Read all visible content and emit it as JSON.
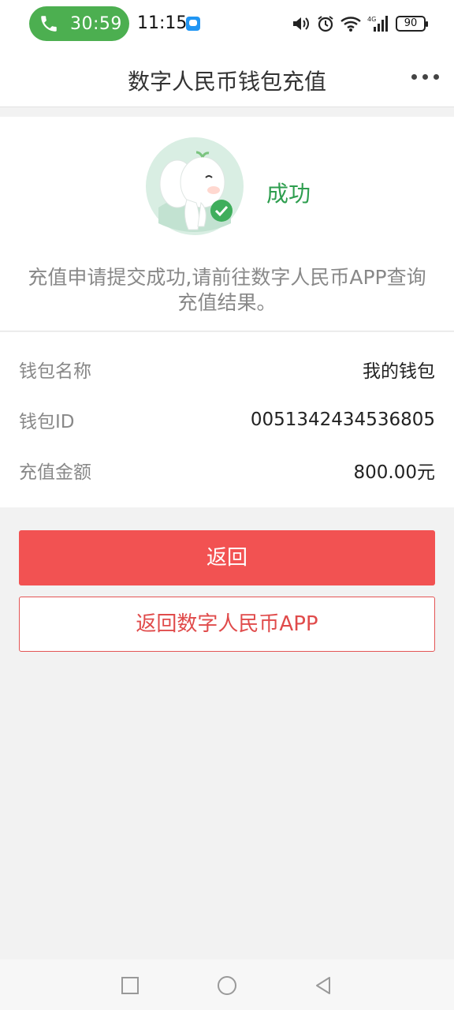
{
  "status_bar": {
    "call_timer": "30:59",
    "time": "11:15",
    "battery": "90",
    "icons": [
      "phone-icon",
      "chat-notification-icon",
      "volume-icon",
      "alarm-icon",
      "wifi-icon",
      "signal-4g-icon",
      "battery-icon"
    ]
  },
  "nav": {
    "title": "数字人民币钱包充值",
    "more_icon": "more-dots-icon"
  },
  "result": {
    "status": "成功",
    "message": "充值申请提交成功,请前往数字人民币APP查询充值结果。",
    "accent_color": "#2e9e4f"
  },
  "details": [
    {
      "label": "钱包名称",
      "value": "我的钱包"
    },
    {
      "label": "钱包ID",
      "value": "0051342434536805"
    },
    {
      "label": "充值金额",
      "value": "800.00元"
    }
  ],
  "buttons": {
    "back": "返回",
    "back_to_app": "返回数字人民币APP",
    "primary_color": "#f25252"
  },
  "system_nav": {
    "icons": [
      "recent-apps-icon",
      "home-icon",
      "back-icon"
    ]
  }
}
